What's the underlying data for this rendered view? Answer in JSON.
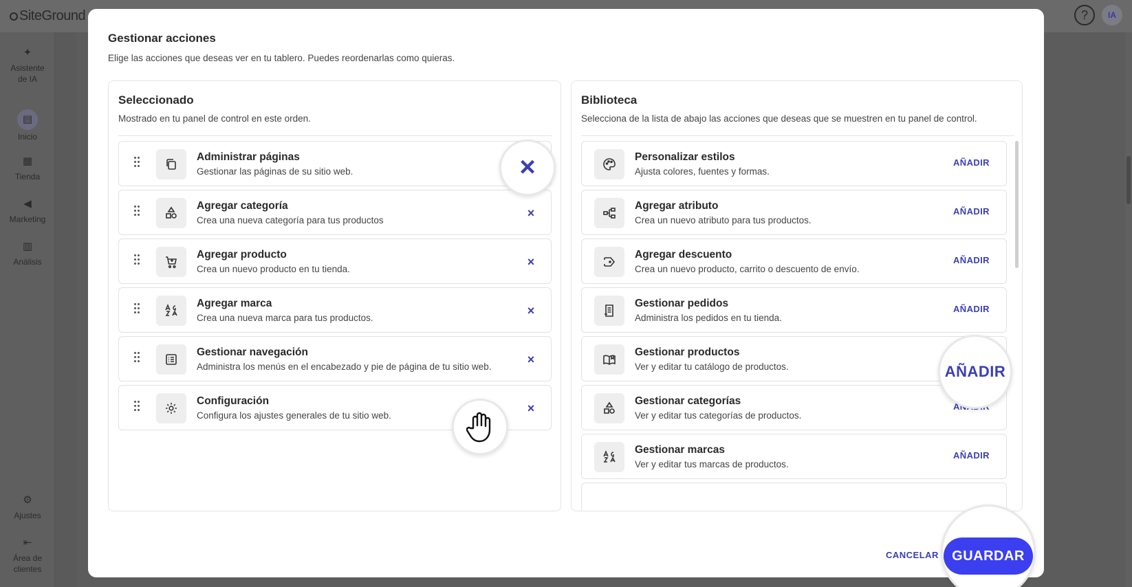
{
  "app": {
    "logo": "SiteGround",
    "help_icon_label": "?",
    "avatar_initials": "IA"
  },
  "sidebar": {
    "items": [
      {
        "label": "Asistente de IA",
        "icon": "sparkle-icon"
      },
      {
        "label": "Inicio",
        "icon": "dashboard-icon"
      },
      {
        "label": "Tienda",
        "icon": "store-icon"
      },
      {
        "label": "Marketing",
        "icon": "megaphone-icon"
      },
      {
        "label": "Análisis",
        "icon": "chart-icon"
      },
      {
        "label": "Ajustes",
        "icon": "gear-icon"
      },
      {
        "label": "Área de clientes",
        "icon": "exit-icon"
      }
    ]
  },
  "modal": {
    "title": "Gestionar acciones",
    "subtitle": "Elige las acciones que deseas ver en tu tablero. Puedes reordenarlas como quieras.",
    "cancel_label": "CANCELAR",
    "save_label": "GUARDAR"
  },
  "selected": {
    "title": "Seleccionado",
    "subtitle": "Mostrado en tu panel de control en este orden.",
    "remove_icon": "×",
    "items": [
      {
        "title": "Administrar páginas",
        "desc": "Gestionar las páginas de su sitio web.",
        "icon": "pages-icon"
      },
      {
        "title": "Agregar categoría",
        "desc": "Crea una nueva categoría para tus productos",
        "icon": "shapes-icon"
      },
      {
        "title": "Agregar producto",
        "desc": "Crea un nuevo producto en tu tienda.",
        "icon": "cart-plus-icon"
      },
      {
        "title": "Agregar marca",
        "desc": "Crea una nueva marca para tus productos.",
        "icon": "brand-icon"
      },
      {
        "title": "Gestionar navegación",
        "desc": "Administra los menús en el encabezado y pie de página de tu sitio web.",
        "icon": "list-icon"
      },
      {
        "title": "Configuración",
        "desc": "Configura los ajustes generales de tu sitio web.",
        "icon": "gear-icon"
      }
    ]
  },
  "library": {
    "title": "Biblioteca",
    "subtitle": "Selecciona de la lista de abajo las acciones que deseas que se muestren en tu panel de control.",
    "add_label": "AÑADIR",
    "items": [
      {
        "title": "Personalizar estilos",
        "desc": "Ajusta colores, fuentes y formas.",
        "icon": "palette-icon"
      },
      {
        "title": "Agregar atributo",
        "desc": "Crea un nuevo atributo para tus productos.",
        "icon": "attribute-icon"
      },
      {
        "title": "Agregar descuento",
        "desc": "Crea un nuevo producto, carrito o descuento de envío.",
        "icon": "discount-icon"
      },
      {
        "title": "Gestionar pedidos",
        "desc": "Administra los pedidos en tu tienda.",
        "icon": "orders-icon"
      },
      {
        "title": "Gestionar productos",
        "desc": "Ver y editar tu catálogo de productos.",
        "icon": "catalog-icon"
      },
      {
        "title": "Gestionar categorías",
        "desc": "Ver y editar tus categorías de productos.",
        "icon": "shapes-icon"
      },
      {
        "title": "Gestionar marcas",
        "desc": "Ver y editar tus marcas de productos.",
        "icon": "brand-icon"
      }
    ]
  },
  "colors": {
    "accent": "#3b3fb5",
    "primary_button": "#3b3ff0"
  }
}
